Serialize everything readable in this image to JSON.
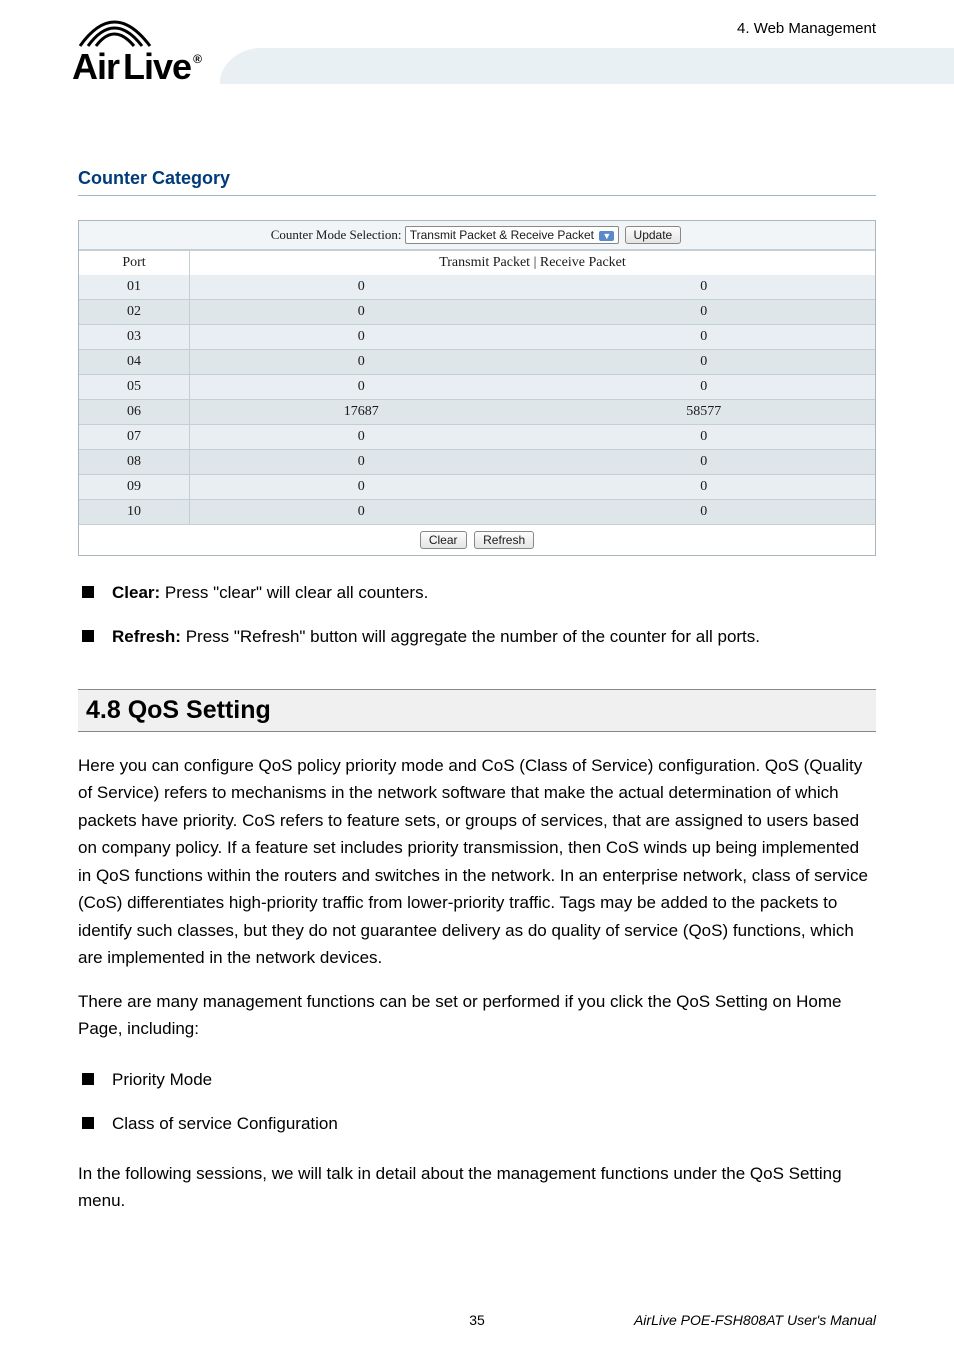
{
  "header": {
    "brand_a": "Air",
    "brand_b": "Live",
    "reg": "®",
    "chapter": "4. Web Management"
  },
  "counter_category": {
    "title": "Counter Category",
    "mode_label": "Counter Mode Selection:",
    "mode_value": "Transmit Packet & Receive Packet",
    "update_btn": "Update",
    "col_port": "Port",
    "col_right": "Transmit Packet | Receive Packet",
    "rows": [
      {
        "port": "01",
        "tx": "0",
        "rx": "0"
      },
      {
        "port": "02",
        "tx": "0",
        "rx": "0"
      },
      {
        "port": "03",
        "tx": "0",
        "rx": "0"
      },
      {
        "port": "04",
        "tx": "0",
        "rx": "0"
      },
      {
        "port": "05",
        "tx": "0",
        "rx": "0"
      },
      {
        "port": "06",
        "tx": "17687",
        "rx": "58577"
      },
      {
        "port": "07",
        "tx": "0",
        "rx": "0"
      },
      {
        "port": "08",
        "tx": "0",
        "rx": "0"
      },
      {
        "port": "09",
        "tx": "0",
        "rx": "0"
      },
      {
        "port": "10",
        "tx": "0",
        "rx": "0"
      }
    ],
    "clear_btn": "Clear",
    "refresh_btn": "Refresh"
  },
  "bullets_top": {
    "clear_label": "Clear:",
    "clear_text": " Press \"clear\" will clear all counters.",
    "refresh_label": "Refresh:",
    "refresh_text": " Press \"Refresh\" button will aggregate the number of the counter for all ports."
  },
  "qos_section": {
    "title": "4.8 QoS Setting",
    "para1": "Here you can configure QoS policy priority mode and CoS (Class of Service) configuration. QoS (Quality of Service) refers to mechanisms in the network software that make the actual determination of which packets have priority. CoS refers to feature sets, or groups of services, that are assigned to users based on company policy. If a feature set includes priority transmission, then CoS winds up being implemented in QoS functions within the routers and switches in the network. In an enterprise network, class of service (CoS) differentiates high-priority traffic from lower-priority traffic. Tags may be added to the packets to identify such classes, but they do not guarantee delivery as do quality of service (QoS) functions, which are implemented in the network devices.",
    "para2": "There are many management functions can be set or performed if you click the QoS Setting on Home Page, including:",
    "opt1": "Priority Mode",
    "opt2": "Class of service Configuration",
    "para3": "In the following sessions, we will talk in detail about the management functions under the QoS Setting menu."
  },
  "footer": {
    "page": "35",
    "manual": "AirLive POE-FSH808AT User's Manual"
  }
}
